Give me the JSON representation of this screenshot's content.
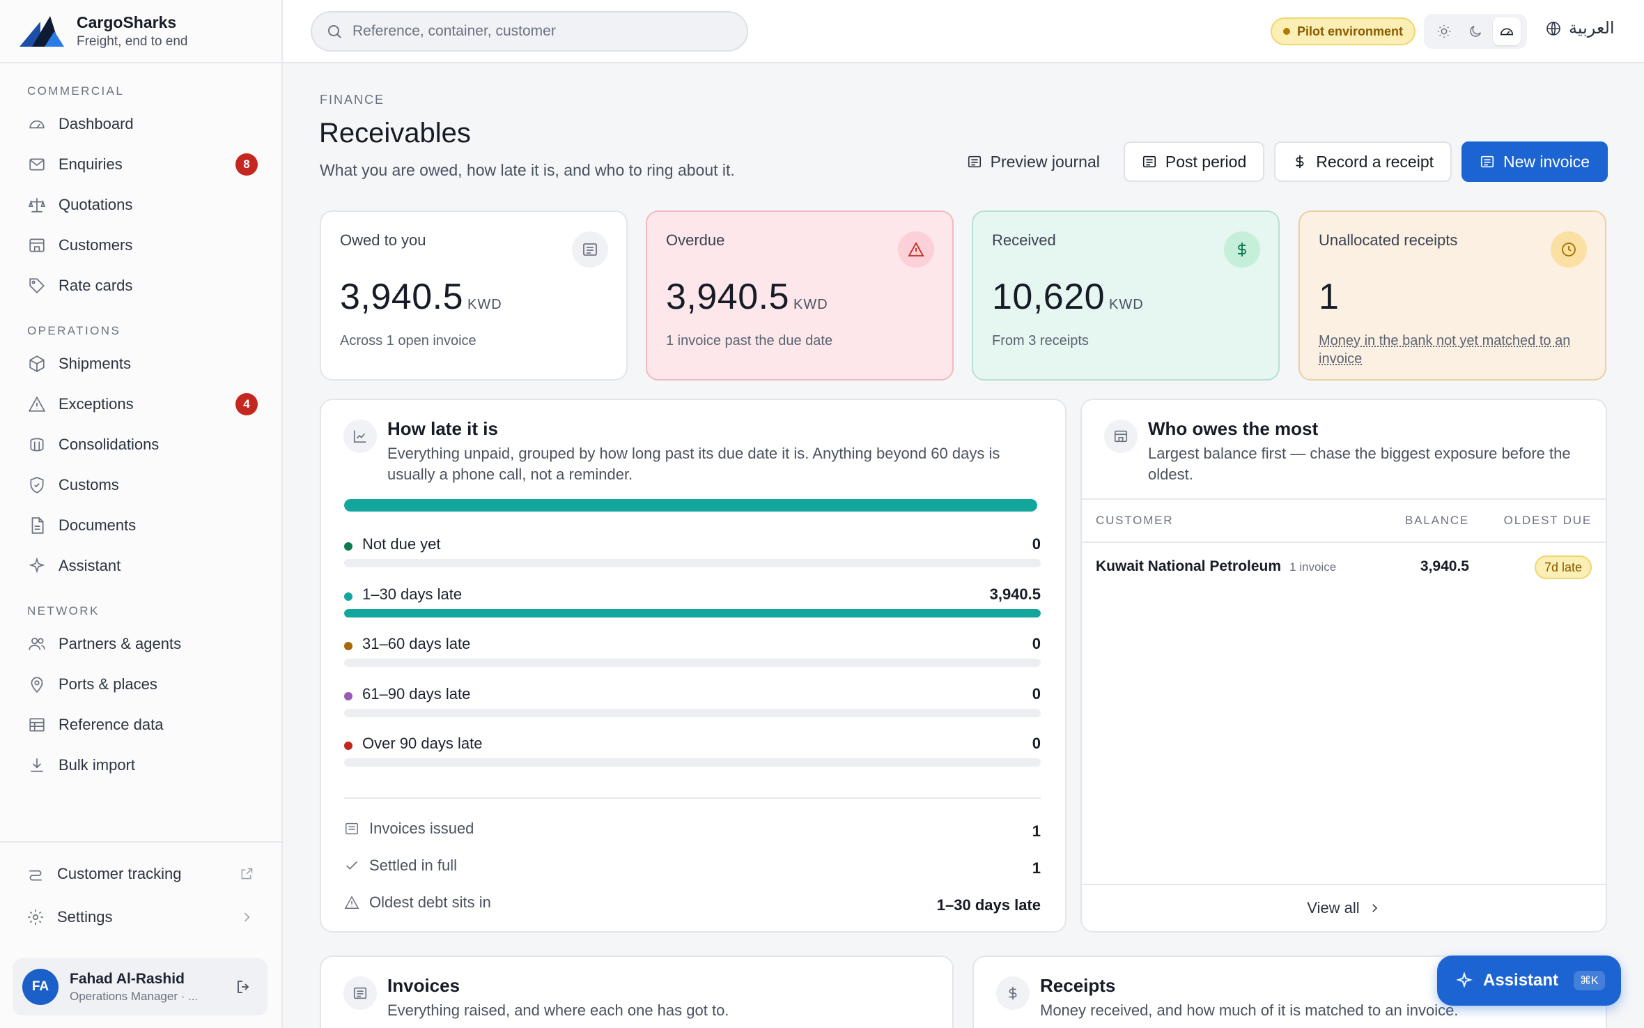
{
  "brand": {
    "name": "CargoSharks",
    "tagline": "Freight, end to end"
  },
  "sidebar": {
    "sections": [
      {
        "label": "COMMERCIAL",
        "items": [
          {
            "label": "Dashboard",
            "icon": "gauge-icon"
          },
          {
            "label": "Enquiries",
            "icon": "mail-icon",
            "badge": "8"
          },
          {
            "label": "Quotations",
            "icon": "scale-icon"
          },
          {
            "label": "Customers",
            "icon": "store-icon"
          },
          {
            "label": "Rate cards",
            "icon": "tag-icon"
          }
        ]
      },
      {
        "label": "OPERATIONS",
        "items": [
          {
            "label": "Shipments",
            "icon": "package-icon"
          },
          {
            "label": "Exceptions",
            "icon": "alert-triangle-icon",
            "badge": "4"
          },
          {
            "label": "Consolidations",
            "icon": "container-icon"
          },
          {
            "label": "Customs",
            "icon": "shield-icon"
          },
          {
            "label": "Documents",
            "icon": "file-icon"
          },
          {
            "label": "Assistant",
            "icon": "sparkle-icon"
          }
        ]
      },
      {
        "label": "NETWORK",
        "items": [
          {
            "label": "Partners & agents",
            "icon": "users-icon"
          },
          {
            "label": "Ports & places",
            "icon": "map-pin-icon"
          },
          {
            "label": "Reference data",
            "icon": "table-icon"
          },
          {
            "label": "Bulk import",
            "icon": "download-icon"
          }
        ]
      }
    ],
    "bottom": [
      {
        "label": "Customer tracking",
        "icon": "route-icon",
        "trail": "external-link-icon"
      },
      {
        "label": "Settings",
        "icon": "gear-icon",
        "trail": "chevron-right-icon"
      }
    ],
    "user": {
      "initials": "FA",
      "name": "Fahad Al-Rashid",
      "role": "Operations Manager · ..."
    }
  },
  "topbar": {
    "search_placeholder": "Reference, container, customer",
    "environment": "Pilot environment",
    "language": "العربية"
  },
  "page": {
    "eyebrow": "FINANCE",
    "title": "Receivables",
    "subtitle": "What you are owed, how late it is, and who to ring about it.",
    "actions": {
      "preview": "Preview journal",
      "post": "Post period",
      "receipt": "Record a receipt",
      "new_invoice": "New invoice"
    }
  },
  "kpis": [
    {
      "label": "Owed to you",
      "value": "3,940.5",
      "unit": "KWD",
      "foot": "Across 1 open invoice",
      "icon": "document-icon"
    },
    {
      "label": "Overdue",
      "value": "3,940.5",
      "unit": "KWD",
      "foot": "1 invoice past the due date",
      "icon": "alert-triangle-icon"
    },
    {
      "label": "Received",
      "value": "10,620",
      "unit": "KWD",
      "foot": "From 3 receipts",
      "icon": "dollar-icon"
    },
    {
      "label": "Unallocated receipts",
      "value": "1",
      "unit": "",
      "foot": "Money in the bank not yet matched to an invoice",
      "icon": "clock-icon"
    }
  ],
  "aging": {
    "title": "How late it is",
    "description": "Everything unpaid, grouped by how long past its due date it is. Anything beyond 60 days is usually a phone call, not a reminder.",
    "total_share": 1.0,
    "buckets": [
      {
        "label": "Not due yet",
        "value": "0",
        "share": 0,
        "color": "#0e7a4f"
      },
      {
        "label": "1–30 days late",
        "value": "3,940.5",
        "share": 1.0,
        "color": "#13a69d"
      },
      {
        "label": "31–60 days late",
        "value": "0",
        "share": 0,
        "color": "#a8680a"
      },
      {
        "label": "61–90 days late",
        "value": "0",
        "share": 0,
        "color": "#9b59b6"
      },
      {
        "label": "Over 90 days late",
        "value": "0",
        "share": 0,
        "color": "#c4271f"
      }
    ],
    "stats": [
      {
        "label": "Invoices issued",
        "value": "1",
        "icon": "document-icon"
      },
      {
        "label": "Settled in full",
        "value": "1",
        "icon": "check-icon"
      },
      {
        "label": "Oldest debt sits in",
        "value": "1–30 days late",
        "icon": "alert-triangle-icon"
      }
    ]
  },
  "debtors": {
    "title": "Who owes the most",
    "description": "Largest balance first — chase the biggest exposure before the oldest.",
    "columns": [
      "CUSTOMER",
      "BALANCE",
      "OLDEST DUE"
    ],
    "rows": [
      {
        "customer": "Kuwait National Petroleum",
        "sub": "1 invoice",
        "balance": "3,940.5",
        "oldest": "7d late"
      }
    ],
    "view_all": "View all"
  },
  "invoices": {
    "title": "Invoices",
    "description": "Everything raised, and where each one has got to."
  },
  "receipts": {
    "title": "Receipts",
    "description": "Money received, and how much of it is matched to an invoice."
  },
  "assistant_fab": {
    "label": "Assistant",
    "shortcut": "⌘K"
  },
  "colors": {
    "primary": "#1b64d2",
    "teal": "#13a69d",
    "danger": "#c4271f",
    "warning_bg": "#fcefb5"
  }
}
